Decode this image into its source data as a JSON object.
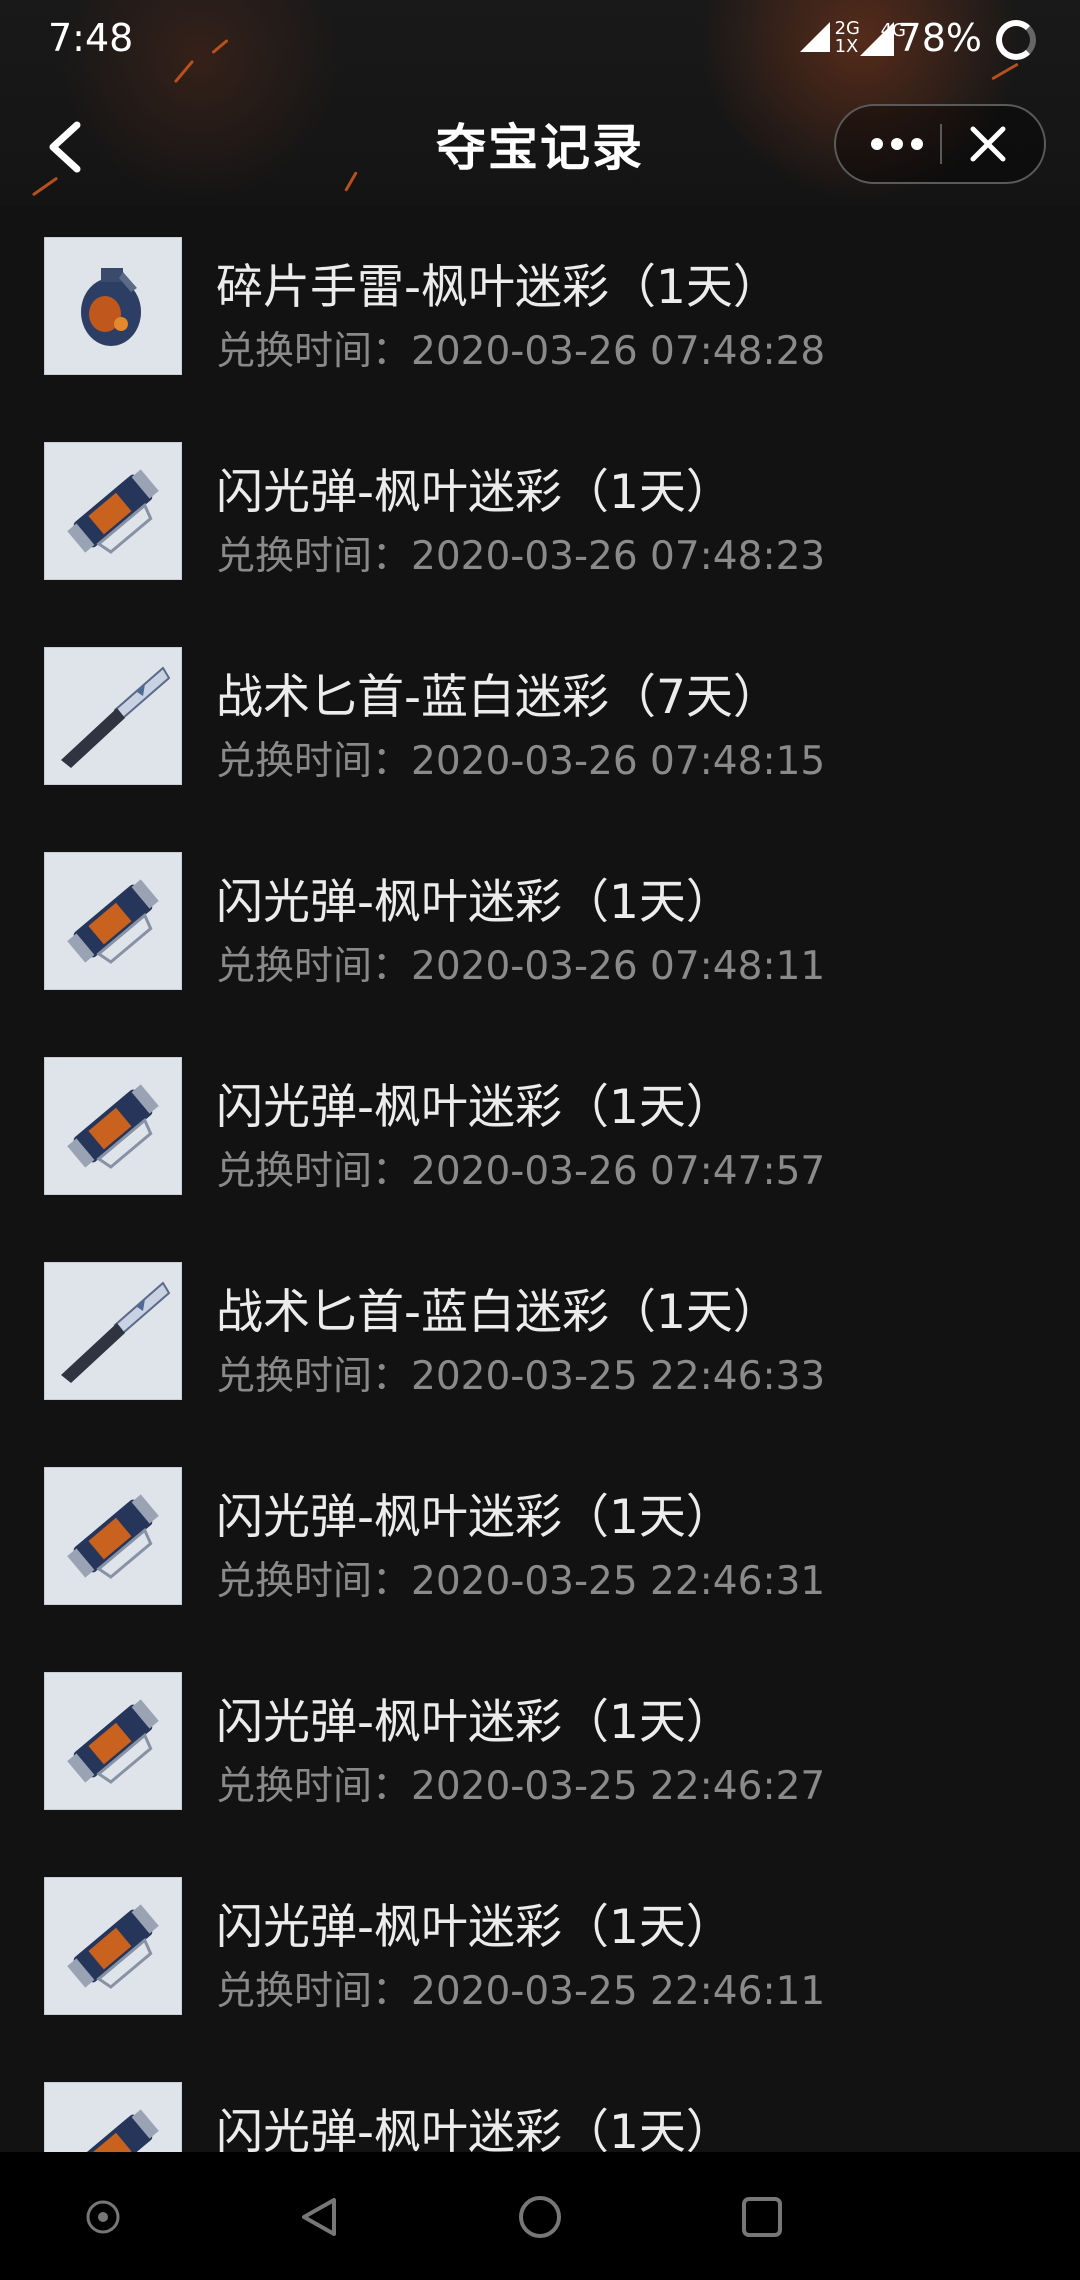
{
  "status": {
    "time": "7:48",
    "signal1": "2G\n1X",
    "signal2": "4G",
    "battery": "78%"
  },
  "nav": {
    "title": "夺宝记录"
  },
  "records": [
    {
      "name": "碎片手雷-枫叶迷彩（1天）",
      "time": "兑换时间：2020-03-26 07:48:28",
      "icon": "grenade"
    },
    {
      "name": "闪光弹-枫叶迷彩（1天）",
      "time": "兑换时间：2020-03-26 07:48:23",
      "icon": "flashbang"
    },
    {
      "name": "战术匕首-蓝白迷彩（7天）",
      "time": "兑换时间：2020-03-26 07:48:15",
      "icon": "knife"
    },
    {
      "name": "闪光弹-枫叶迷彩（1天）",
      "time": "兑换时间：2020-03-26 07:48:11",
      "icon": "flashbang"
    },
    {
      "name": "闪光弹-枫叶迷彩（1天）",
      "time": "兑换时间：2020-03-26 07:47:57",
      "icon": "flashbang"
    },
    {
      "name": "战术匕首-蓝白迷彩（1天）",
      "time": "兑换时间：2020-03-25 22:46:33",
      "icon": "knife"
    },
    {
      "name": "闪光弹-枫叶迷彩（1天）",
      "time": "兑换时间：2020-03-25 22:46:31",
      "icon": "flashbang"
    },
    {
      "name": "闪光弹-枫叶迷彩（1天）",
      "time": "兑换时间：2020-03-25 22:46:27",
      "icon": "flashbang"
    },
    {
      "name": "闪光弹-枫叶迷彩（1天）",
      "time": "兑换时间：2020-03-25 22:46:11",
      "icon": "flashbang"
    },
    {
      "name": "闪光弹-枫叶迷彩（1天）",
      "time": "",
      "icon": "flashbang"
    }
  ]
}
